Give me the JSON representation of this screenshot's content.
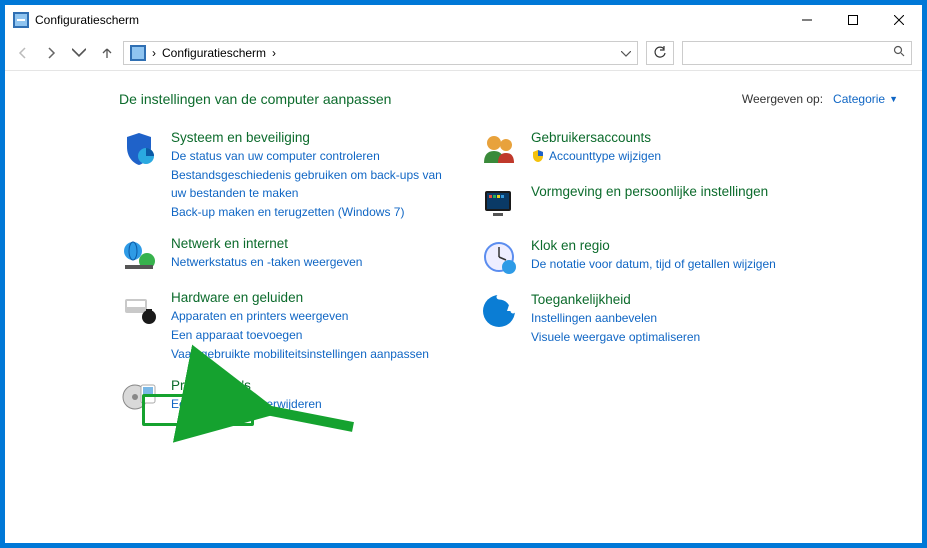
{
  "window": {
    "title": "Configuratiescherm"
  },
  "address": {
    "root": "Configuratiescherm",
    "sep": "›"
  },
  "search": {
    "placeholder": ""
  },
  "heading": "De instellingen van de computer aanpassen",
  "viewby": {
    "label": "Weergeven op:",
    "value": "Categorie"
  },
  "left": [
    {
      "title": "Systeem en beveiliging",
      "links": [
        "De status van uw computer controleren",
        "Bestandsgeschiedenis gebruiken om back-ups van uw bestanden te maken",
        "Back-up maken en terugzetten (Windows 7)"
      ]
    },
    {
      "title": "Netwerk en internet",
      "links": [
        "Netwerkstatus en -taken weergeven"
      ]
    },
    {
      "title": "Hardware en geluiden",
      "links": [
        "Apparaten en printers weergeven",
        "Een apparaat toevoegen",
        "Vaak gebruikte mobiliteitsinstellingen aanpassen"
      ]
    },
    {
      "title": "Programma's",
      "links": [
        "Een programma verwijderen"
      ]
    }
  ],
  "right": [
    {
      "title": "Gebruikersaccounts",
      "links": [
        "Accounttype wijzigen"
      ],
      "shield": true
    },
    {
      "title": "Vormgeving en persoonlijke instellingen",
      "links": []
    },
    {
      "title": "Klok en regio",
      "links": [
        "De notatie voor datum, tijd of getallen wijzigen"
      ]
    },
    {
      "title": "Toegankelijkheid",
      "links": [
        "Instellingen aanbevelen",
        "Visuele weergave optimaliseren"
      ]
    }
  ]
}
